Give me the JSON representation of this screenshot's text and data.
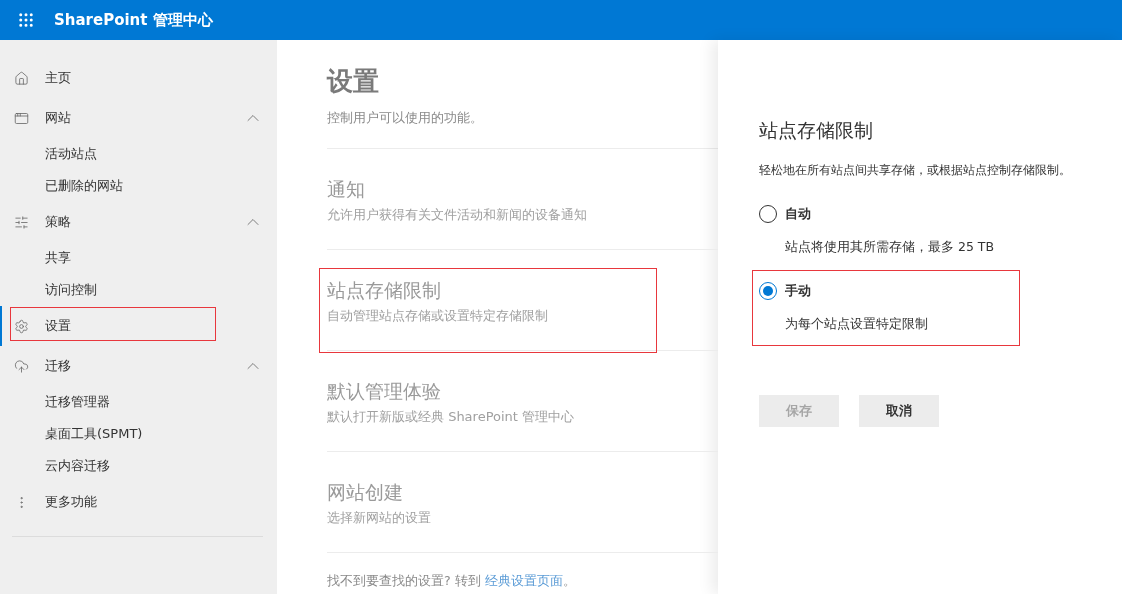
{
  "header": {
    "title": "SharePoint 管理中心"
  },
  "nav": [
    {
      "label": "主页",
      "selected": false,
      "highlighted": false
    },
    {
      "label": "网站",
      "selected": false,
      "highlighted": false,
      "expanded": true,
      "children": [
        {
          "label": "活动站点",
          "selected": false
        },
        {
          "label": "已删除的网站",
          "selected": false
        }
      ]
    },
    {
      "label": "策略",
      "selected": false,
      "highlighted": false,
      "expanded": true,
      "children": [
        {
          "label": "共享",
          "selected": false
        },
        {
          "label": "访问控制",
          "selected": false
        }
      ]
    },
    {
      "label": "设置",
      "selected": true,
      "highlighted": true
    },
    {
      "label": "迁移",
      "selected": false,
      "highlighted": false,
      "expanded": true,
      "children": [
        {
          "label": "迁移管理器",
          "selected": false
        },
        {
          "label": "桌面工具(SPMT)",
          "selected": false
        },
        {
          "label": "云内容迁移",
          "selected": false
        }
      ]
    },
    {
      "label": "更多功能",
      "selected": false,
      "highlighted": false
    }
  ],
  "page": {
    "title": "设置",
    "subtitle": "控制用户可以使用的功能。",
    "sections": [
      {
        "title": "通知",
        "description": "允许用户获得有关文件活动和新闻的设备通知",
        "highlighted": false
      },
      {
        "title": "站点存储限制",
        "description": "自动管理站点存储或设置特定存储限制",
        "highlighted": true
      },
      {
        "title": "默认管理体验",
        "description": "默认打开新版或经典 SharePoint 管理中心",
        "highlighted": false
      },
      {
        "title": "网站创建",
        "description": "选择新网站的设置",
        "highlighted": false
      }
    ],
    "footer": {
      "text": "找不到要查找的设置? 转到 ",
      "link": "经典设置页面",
      "end": "。"
    }
  },
  "panel": {
    "title": "站点存储限制",
    "description": "轻松地在所有站点间共享存储，或根据站点控制存储限制。",
    "options": [
      {
        "label": "自动",
        "description": "站点将使用其所需存储，最多 25 TB",
        "selected": false,
        "highlighted": false
      },
      {
        "label": "手动",
        "description": "为每个站点设置特定限制",
        "selected": true,
        "highlighted": true
      }
    ],
    "buttons": [
      {
        "label": "保存",
        "disabled": true
      },
      {
        "label": "取消",
        "disabled": false
      }
    ]
  }
}
